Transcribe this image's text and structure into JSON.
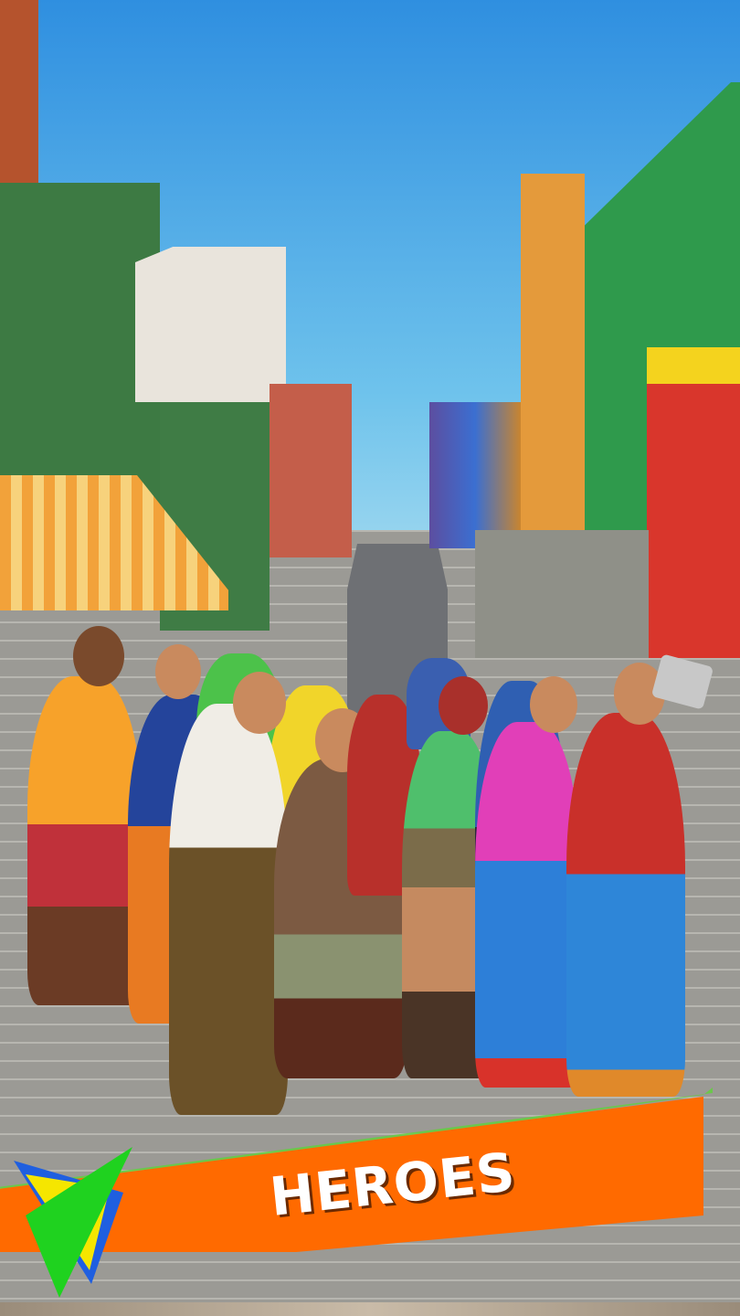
{
  "banner": {
    "title": "HEROES",
    "color": "#ff6a00",
    "glow": "#5fd23a"
  },
  "logo": {
    "icon": "triangle-logo-icon",
    "colors": [
      "#1f5fe0",
      "#f5e600",
      "#1fd21f"
    ]
  }
}
